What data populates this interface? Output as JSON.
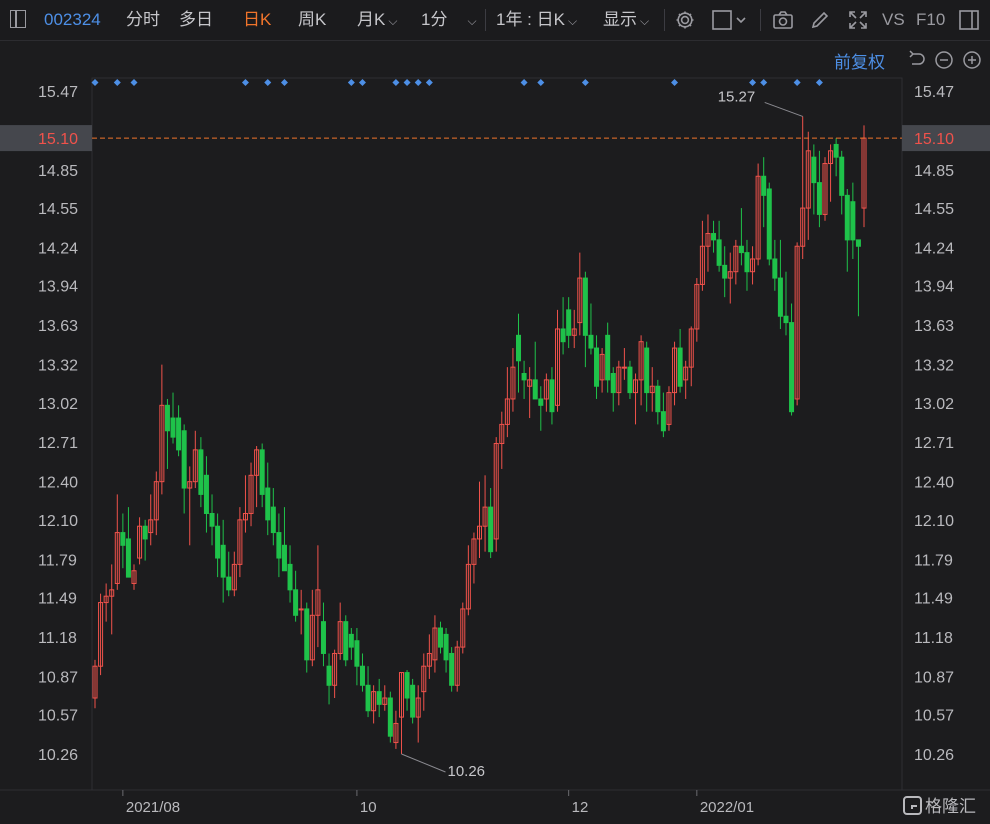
{
  "toolbar": {
    "code": "002324",
    "items": [
      "分时",
      "多日",
      "日K",
      "周K",
      "月K",
      "1分",
      "1年 : 日K",
      "显示"
    ],
    "vs": "VS",
    "f10": "F10"
  },
  "adjust_label": "前复权",
  "colors": {
    "up": "#f0524b",
    "down": "#1fc24a",
    "accent": "#f0742b",
    "link": "#4d8fe6"
  },
  "icons": [
    "settings-gear-icon",
    "square-checkbox-icon",
    "camera-icon",
    "pencil-icon",
    "fullscreen-icon",
    "layout-icon",
    "undo-icon",
    "zoom-out-icon",
    "zoom-in-icon"
  ],
  "chart_data": {
    "type": "candlestick",
    "y_ticks": [
      "15.47",
      "15.10",
      "14.85",
      "14.55",
      "14.24",
      "13.94",
      "13.63",
      "13.32",
      "13.02",
      "12.71",
      "12.40",
      "12.10",
      "11.79",
      "11.49",
      "11.18",
      "10.87",
      "10.57",
      "10.26"
    ],
    "x_ticks": [
      "2021/08",
      "10",
      "12",
      "2022/01"
    ],
    "current_price": "15.10",
    "high_annotation": "15.27",
    "low_annotation": "10.26",
    "ylim": [
      10.1,
      15.6
    ],
    "watermark": "格隆汇",
    "candles": [
      {
        "date": "2021-07-26",
        "o": 10.7,
        "h": 11.0,
        "l": 10.62,
        "c": 10.95
      },
      {
        "date": "2021-07-27",
        "o": 10.95,
        "h": 11.52,
        "l": 10.88,
        "c": 11.45
      },
      {
        "date": "2021-07-28",
        "o": 11.45,
        "h": 11.6,
        "l": 11.3,
        "c": 11.5
      },
      {
        "date": "2021-07-29",
        "o": 11.5,
        "h": 11.75,
        "l": 11.2,
        "c": 11.55
      },
      {
        "date": "2021-07-30",
        "o": 11.6,
        "h": 12.3,
        "l": 11.55,
        "c": 12.0
      },
      {
        "date": "2021-08-02",
        "o": 12.0,
        "h": 12.15,
        "l": 11.72,
        "c": 11.9
      },
      {
        "date": "2021-08-03",
        "o": 11.95,
        "h": 12.2,
        "l": 11.7,
        "c": 11.65
      },
      {
        "date": "2021-08-04",
        "o": 11.6,
        "h": 11.75,
        "l": 11.55,
        "c": 11.7
      },
      {
        "date": "2021-08-05",
        "o": 11.8,
        "h": 12.12,
        "l": 11.75,
        "c": 12.05
      },
      {
        "date": "2021-08-06",
        "o": 12.05,
        "h": 12.1,
        "l": 11.78,
        "c": 11.95
      },
      {
        "date": "2021-08-09",
        "o": 12.0,
        "h": 12.3,
        "l": 11.9,
        "c": 12.1
      },
      {
        "date": "2021-08-10",
        "o": 12.1,
        "h": 12.48,
        "l": 11.98,
        "c": 12.4
      },
      {
        "date": "2021-08-11",
        "o": 12.4,
        "h": 13.32,
        "l": 12.3,
        "c": 13.0
      },
      {
        "date": "2021-08-12",
        "o": 13.0,
        "h": 13.05,
        "l": 12.5,
        "c": 12.8
      },
      {
        "date": "2021-08-13",
        "o": 12.9,
        "h": 13.1,
        "l": 12.7,
        "c": 12.75
      },
      {
        "date": "2021-08-16",
        "o": 12.9,
        "h": 13.0,
        "l": 12.6,
        "c": 12.65
      },
      {
        "date": "2021-08-17",
        "o": 12.8,
        "h": 12.85,
        "l": 12.15,
        "c": 12.35
      },
      {
        "date": "2021-08-18",
        "o": 12.35,
        "h": 12.52,
        "l": 11.9,
        "c": 12.4
      },
      {
        "date": "2021-08-19",
        "o": 12.4,
        "h": 12.8,
        "l": 12.35,
        "c": 12.65
      },
      {
        "date": "2021-08-20",
        "o": 12.65,
        "h": 12.75,
        "l": 12.2,
        "c": 12.3
      },
      {
        "date": "2021-08-23",
        "o": 12.45,
        "h": 12.6,
        "l": 12.0,
        "c": 12.15
      },
      {
        "date": "2021-08-24",
        "o": 12.15,
        "h": 12.3,
        "l": 11.9,
        "c": 12.05
      },
      {
        "date": "2021-08-25",
        "o": 12.05,
        "h": 12.15,
        "l": 11.65,
        "c": 11.8
      },
      {
        "date": "2021-08-26",
        "o": 11.9,
        "h": 12.1,
        "l": 11.45,
        "c": 11.65
      },
      {
        "date": "2021-08-27",
        "o": 11.65,
        "h": 11.85,
        "l": 11.5,
        "c": 11.55
      },
      {
        "date": "2021-08-30",
        "o": 11.55,
        "h": 11.85,
        "l": 11.5,
        "c": 11.75
      },
      {
        "date": "2021-08-31",
        "o": 11.75,
        "h": 12.2,
        "l": 11.65,
        "c": 12.1
      },
      {
        "date": "2021-09-01",
        "o": 12.1,
        "h": 12.45,
        "l": 12.0,
        "c": 12.15
      },
      {
        "date": "2021-09-02",
        "o": 12.15,
        "h": 12.55,
        "l": 12.05,
        "c": 12.45
      },
      {
        "date": "2021-09-03",
        "o": 12.45,
        "h": 12.68,
        "l": 12.2,
        "c": 12.65
      },
      {
        "date": "2021-09-06",
        "o": 12.65,
        "h": 12.7,
        "l": 12.2,
        "c": 12.3
      },
      {
        "date": "2021-09-07",
        "o": 12.35,
        "h": 12.55,
        "l": 11.98,
        "c": 12.1
      },
      {
        "date": "2021-09-08",
        "o": 12.2,
        "h": 12.35,
        "l": 11.9,
        "c": 12.0
      },
      {
        "date": "2021-09-09",
        "o": 12.0,
        "h": 12.15,
        "l": 11.65,
        "c": 11.8
      },
      {
        "date": "2021-09-10",
        "o": 11.9,
        "h": 12.2,
        "l": 11.7,
        "c": 11.7
      },
      {
        "date": "2021-09-13",
        "o": 11.75,
        "h": 11.9,
        "l": 11.45,
        "c": 11.55
      },
      {
        "date": "2021-09-14",
        "o": 11.55,
        "h": 11.7,
        "l": 11.3,
        "c": 11.35
      },
      {
        "date": "2021-09-15",
        "o": 11.4,
        "h": 11.55,
        "l": 11.2,
        "c": 11.4
      },
      {
        "date": "2021-09-16",
        "o": 11.4,
        "h": 11.45,
        "l": 10.9,
        "c": 11.0
      },
      {
        "date": "2021-09-17",
        "o": 11.0,
        "h": 11.55,
        "l": 10.95,
        "c": 11.35
      },
      {
        "date": "2021-09-22",
        "o": 11.35,
        "h": 11.9,
        "l": 11.1,
        "c": 11.55
      },
      {
        "date": "2021-09-23",
        "o": 11.3,
        "h": 11.45,
        "l": 10.95,
        "c": 11.05
      },
      {
        "date": "2021-09-24",
        "o": 10.95,
        "h": 11.05,
        "l": 10.65,
        "c": 10.8
      },
      {
        "date": "2021-09-27",
        "o": 10.8,
        "h": 11.08,
        "l": 10.7,
        "c": 11.05
      },
      {
        "date": "2021-09-28",
        "o": 11.05,
        "h": 11.45,
        "l": 11.0,
        "c": 11.3
      },
      {
        "date": "2021-09-29",
        "o": 11.3,
        "h": 11.35,
        "l": 10.95,
        "c": 11.0
      },
      {
        "date": "2021-09-30",
        "o": 11.2,
        "h": 11.25,
        "l": 11.0,
        "c": 11.1
      },
      {
        "date": "2021-10-08",
        "o": 11.15,
        "h": 11.25,
        "l": 10.8,
        "c": 10.95
      },
      {
        "date": "2021-10-11",
        "o": 10.95,
        "h": 11.05,
        "l": 10.75,
        "c": 10.8
      },
      {
        "date": "2021-10-12",
        "o": 10.8,
        "h": 10.95,
        "l": 10.55,
        "c": 10.6
      },
      {
        "date": "2021-10-13",
        "o": 10.6,
        "h": 10.8,
        "l": 10.5,
        "c": 10.75
      },
      {
        "date": "2021-10-14",
        "o": 10.75,
        "h": 10.85,
        "l": 10.55,
        "c": 10.65
      },
      {
        "date": "2021-10-15",
        "o": 10.65,
        "h": 10.8,
        "l": 10.6,
        "c": 10.7
      },
      {
        "date": "2021-10-18",
        "o": 10.7,
        "h": 10.75,
        "l": 10.35,
        "c": 10.4
      },
      {
        "date": "2021-10-19",
        "o": 10.35,
        "h": 10.6,
        "l": 10.3,
        "c": 10.5
      },
      {
        "date": "2021-10-20",
        "o": 10.55,
        "h": 10.9,
        "l": 10.26,
        "c": 10.9
      },
      {
        "date": "2021-10-21",
        "o": 10.9,
        "h": 10.92,
        "l": 10.6,
        "c": 10.7
      },
      {
        "date": "2021-10-22",
        "o": 10.8,
        "h": 10.85,
        "l": 10.5,
        "c": 10.55
      },
      {
        "date": "2021-10-25",
        "o": 10.55,
        "h": 10.8,
        "l": 10.35,
        "c": 10.7
      },
      {
        "date": "2021-10-26",
        "o": 10.75,
        "h": 11.05,
        "l": 10.6,
        "c": 10.95
      },
      {
        "date": "2021-10-27",
        "o": 10.95,
        "h": 11.2,
        "l": 10.85,
        "c": 11.05
      },
      {
        "date": "2021-10-28",
        "o": 11.0,
        "h": 11.35,
        "l": 10.9,
        "c": 11.25
      },
      {
        "date": "2021-10-29",
        "o": 11.25,
        "h": 11.3,
        "l": 11.05,
        "c": 11.1
      },
      {
        "date": "2021-11-01",
        "o": 11.2,
        "h": 11.25,
        "l": 10.9,
        "c": 11.0
      },
      {
        "date": "2021-11-02",
        "o": 11.05,
        "h": 11.1,
        "l": 10.75,
        "c": 10.8
      },
      {
        "date": "2021-11-03",
        "o": 10.8,
        "h": 11.15,
        "l": 10.75,
        "c": 11.1
      },
      {
        "date": "2021-11-04",
        "o": 11.1,
        "h": 11.45,
        "l": 11.05,
        "c": 11.4
      },
      {
        "date": "2021-11-05",
        "o": 11.4,
        "h": 11.9,
        "l": 11.35,
        "c": 11.75
      },
      {
        "date": "2021-11-08",
        "o": 11.75,
        "h": 12.0,
        "l": 11.6,
        "c": 11.95
      },
      {
        "date": "2021-11-09",
        "o": 11.95,
        "h": 12.4,
        "l": 11.8,
        "c": 12.05
      },
      {
        "date": "2021-11-10",
        "o": 12.05,
        "h": 12.45,
        "l": 11.85,
        "c": 12.2
      },
      {
        "date": "2021-11-11",
        "o": 12.2,
        "h": 12.35,
        "l": 11.8,
        "c": 11.85
      },
      {
        "date": "2021-11-12",
        "o": 11.95,
        "h": 12.75,
        "l": 11.85,
        "c": 12.7
      },
      {
        "date": "2021-11-15",
        "o": 12.7,
        "h": 12.95,
        "l": 12.5,
        "c": 12.85
      },
      {
        "date": "2021-11-16",
        "o": 12.85,
        "h": 13.3,
        "l": 12.75,
        "c": 13.05
      },
      {
        "date": "2021-11-17",
        "o": 13.05,
        "h": 13.45,
        "l": 12.95,
        "c": 13.3
      },
      {
        "date": "2021-11-18",
        "o": 13.55,
        "h": 13.72,
        "l": 13.1,
        "c": 13.35
      },
      {
        "date": "2021-11-19",
        "o": 13.25,
        "h": 13.35,
        "l": 13.05,
        "c": 13.2
      },
      {
        "date": "2021-11-22",
        "o": 13.15,
        "h": 13.3,
        "l": 12.9,
        "c": 13.2
      },
      {
        "date": "2021-11-23",
        "o": 13.2,
        "h": 13.5,
        "l": 13.05,
        "c": 13.05
      },
      {
        "date": "2021-11-24",
        "o": 13.05,
        "h": 13.15,
        "l": 12.8,
        "c": 13.0
      },
      {
        "date": "2021-11-25",
        "o": 13.05,
        "h": 13.25,
        "l": 12.95,
        "c": 13.2
      },
      {
        "date": "2021-11-26",
        "o": 13.2,
        "h": 13.3,
        "l": 12.85,
        "c": 12.95
      },
      {
        "date": "2021-11-29",
        "o": 13.0,
        "h": 13.75,
        "l": 12.95,
        "c": 13.6
      },
      {
        "date": "2021-11-30",
        "o": 13.6,
        "h": 13.85,
        "l": 13.4,
        "c": 13.5
      },
      {
        "date": "2021-12-01",
        "o": 13.75,
        "h": 13.85,
        "l": 13.45,
        "c": 13.55
      },
      {
        "date": "2021-12-02",
        "o": 13.55,
        "h": 13.75,
        "l": 13.45,
        "c": 13.6
      },
      {
        "date": "2021-12-03",
        "o": 13.65,
        "h": 14.2,
        "l": 13.55,
        "c": 14.0
      },
      {
        "date": "2021-12-06",
        "o": 14.0,
        "h": 14.05,
        "l": 13.3,
        "c": 13.55
      },
      {
        "date": "2021-12-07",
        "o": 13.55,
        "h": 13.8,
        "l": 13.4,
        "c": 13.45
      },
      {
        "date": "2021-12-08",
        "o": 13.45,
        "h": 13.55,
        "l": 13.05,
        "c": 13.15
      },
      {
        "date": "2021-12-09",
        "o": 13.2,
        "h": 13.45,
        "l": 13.1,
        "c": 13.4
      },
      {
        "date": "2021-12-10",
        "o": 13.55,
        "h": 13.65,
        "l": 13.1,
        "c": 13.2
      },
      {
        "date": "2021-12-13",
        "o": 13.25,
        "h": 13.3,
        "l": 12.95,
        "c": 13.1
      },
      {
        "date": "2021-12-14",
        "o": 13.1,
        "h": 13.35,
        "l": 13.0,
        "c": 13.3
      },
      {
        "date": "2021-12-15",
        "o": 13.3,
        "h": 13.45,
        "l": 13.2,
        "c": 13.3
      },
      {
        "date": "2021-12-16",
        "o": 13.3,
        "h": 13.35,
        "l": 13.05,
        "c": 13.1
      },
      {
        "date": "2021-12-17",
        "o": 13.1,
        "h": 13.25,
        "l": 12.85,
        "c": 13.2
      },
      {
        "date": "2021-12-20",
        "o": 13.2,
        "h": 13.55,
        "l": 13.0,
        "c": 13.5
      },
      {
        "date": "2021-12-21",
        "o": 13.45,
        "h": 13.5,
        "l": 12.95,
        "c": 13.1
      },
      {
        "date": "2021-12-22",
        "o": 13.1,
        "h": 13.3,
        "l": 12.95,
        "c": 13.15
      },
      {
        "date": "2021-12-23",
        "o": 13.15,
        "h": 13.2,
        "l": 12.85,
        "c": 12.95
      },
      {
        "date": "2021-12-24",
        "o": 12.95,
        "h": 13.1,
        "l": 12.75,
        "c": 12.8
      },
      {
        "date": "2021-12-27",
        "o": 12.85,
        "h": 13.15,
        "l": 12.8,
        "c": 13.1
      },
      {
        "date": "2021-12-28",
        "o": 13.1,
        "h": 13.5,
        "l": 13.0,
        "c": 13.45
      },
      {
        "date": "2021-12-29",
        "o": 13.45,
        "h": 13.6,
        "l": 13.1,
        "c": 13.15
      },
      {
        "date": "2021-12-30",
        "o": 13.2,
        "h": 13.35,
        "l": 13.05,
        "c": 13.3
      },
      {
        "date": "2021-12-31",
        "o": 13.3,
        "h": 13.62,
        "l": 13.15,
        "c": 13.6
      },
      {
        "date": "2022-01-04",
        "o": 13.6,
        "h": 14.0,
        "l": 13.5,
        "c": 13.95
      },
      {
        "date": "2022-01-05",
        "o": 13.95,
        "h": 14.45,
        "l": 13.9,
        "c": 14.25
      },
      {
        "date": "2022-01-06",
        "o": 14.25,
        "h": 14.5,
        "l": 14.05,
        "c": 14.35
      },
      {
        "date": "2022-01-07",
        "o": 14.35,
        "h": 14.45,
        "l": 14.2,
        "c": 14.3
      },
      {
        "date": "2022-01-10",
        "o": 14.3,
        "h": 14.45,
        "l": 14.05,
        "c": 14.1
      },
      {
        "date": "2022-01-11",
        "o": 14.1,
        "h": 14.25,
        "l": 13.85,
        "c": 14.0
      },
      {
        "date": "2022-01-12",
        "o": 14.0,
        "h": 14.2,
        "l": 13.8,
        "c": 14.05
      },
      {
        "date": "2022-01-13",
        "o": 14.05,
        "h": 14.3,
        "l": 13.95,
        "c": 14.25
      },
      {
        "date": "2022-01-14",
        "o": 14.25,
        "h": 14.55,
        "l": 14.1,
        "c": 14.2
      },
      {
        "date": "2022-01-17",
        "o": 14.2,
        "h": 14.3,
        "l": 13.9,
        "c": 14.05
      },
      {
        "date": "2022-01-18",
        "o": 14.05,
        "h": 14.25,
        "l": 13.95,
        "c": 14.15
      },
      {
        "date": "2022-01-19",
        "o": 14.15,
        "h": 14.9,
        "l": 14.1,
        "c": 14.8
      },
      {
        "date": "2022-01-20",
        "o": 14.8,
        "h": 14.95,
        "l": 14.4,
        "c": 14.65
      },
      {
        "date": "2022-01-21",
        "o": 14.7,
        "h": 14.75,
        "l": 14.1,
        "c": 14.15
      },
      {
        "date": "2022-01-24",
        "o": 14.15,
        "h": 14.3,
        "l": 13.9,
        "c": 14.0
      },
      {
        "date": "2022-01-25",
        "o": 14.0,
        "h": 14.3,
        "l": 13.6,
        "c": 13.7
      },
      {
        "date": "2022-01-26",
        "o": 13.7,
        "h": 14.05,
        "l": 13.55,
        "c": 13.65
      },
      {
        "date": "2022-01-27",
        "o": 13.65,
        "h": 13.8,
        "l": 12.92,
        "c": 12.95
      },
      {
        "date": "2022-01-28",
        "o": 13.05,
        "h": 14.28,
        "l": 13.0,
        "c": 14.25
      },
      {
        "date": "2022-02-07",
        "o": 14.25,
        "h": 15.27,
        "l": 14.15,
        "c": 14.55
      },
      {
        "date": "2022-02-08",
        "o": 14.55,
        "h": 15.15,
        "l": 14.3,
        "c": 15.0
      },
      {
        "date": "2022-02-09",
        "o": 14.95,
        "h": 15.05,
        "l": 14.5,
        "c": 14.75
      },
      {
        "date": "2022-02-10",
        "o": 14.75,
        "h": 15.0,
        "l": 14.4,
        "c": 14.5
      },
      {
        "date": "2022-02-11",
        "o": 14.5,
        "h": 14.95,
        "l": 14.45,
        "c": 14.9
      },
      {
        "date": "2022-02-14",
        "o": 14.9,
        "h": 15.05,
        "l": 14.6,
        "c": 15.0
      },
      {
        "date": "2022-02-15",
        "o": 15.05,
        "h": 15.1,
        "l": 14.8,
        "c": 14.95
      },
      {
        "date": "2022-02-16",
        "o": 14.95,
        "h": 15.0,
        "l": 14.5,
        "c": 14.65
      },
      {
        "date": "2022-02-17",
        "o": 14.65,
        "h": 14.7,
        "l": 14.05,
        "c": 14.3
      },
      {
        "date": "2022-02-18",
        "o": 14.6,
        "h": 14.75,
        "l": 14.15,
        "c": 14.3
      },
      {
        "date": "2022-02-21",
        "o": 14.3,
        "h": 14.3,
        "l": 13.7,
        "c": 14.25
      },
      {
        "date": "2022-02-22",
        "o": 14.55,
        "h": 15.2,
        "l": 14.4,
        "c": 15.1
      }
    ]
  }
}
